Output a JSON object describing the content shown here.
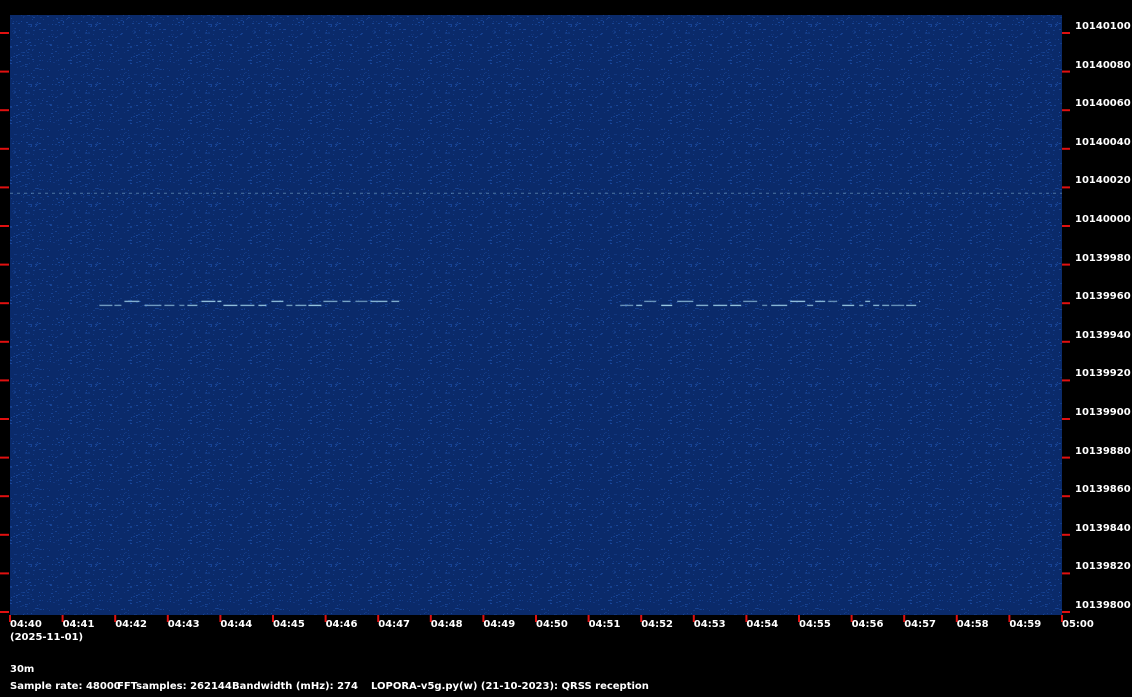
{
  "waterfall": {
    "background_color": "#0a2a6a",
    "noise_color": "#1a4aa0",
    "signal_color": "#9fd0e8",
    "tick_color": "#e01010",
    "frequency_axis": {
      "unit": "Hz",
      "labels": [
        "10140100",
        "10140080",
        "10140060",
        "10140040",
        "10140020",
        "10140000",
        "10139980",
        "10139960",
        "10139940",
        "10139920",
        "10139900",
        "10139880",
        "10139860",
        "10139840",
        "10139820",
        "10139800"
      ]
    },
    "time_axis": {
      "labels": [
        "04:40",
        "04:41",
        "04:42",
        "04:43",
        "04:44",
        "04:45",
        "04:46",
        "04:47",
        "04:48",
        "04:49",
        "04:50",
        "04:51",
        "04:52",
        "04:53",
        "04:54",
        "04:55",
        "04:56",
        "04:57",
        "04:58",
        "04:59",
        "05:00"
      ],
      "date": "(2025-11-01)"
    },
    "carrier": {
      "frequency_hz": 10140017
    },
    "transmissions": [
      {
        "start": "04:41:42",
        "end": "04:47:24",
        "frequency_hz": 10139960
      },
      {
        "start": "04:51:36",
        "end": "04:57:18",
        "frequency_hz": 10139960
      }
    ]
  },
  "footer": {
    "band": "30m",
    "sample_rate": "Sample rate: 48000",
    "fft_samples": "FFTsamples: 262144",
    "bandwidth": "Bandwidth (mHz): 274",
    "software": "LOPORA-v5g.py(w) (21-10-2023): QRSS reception"
  }
}
